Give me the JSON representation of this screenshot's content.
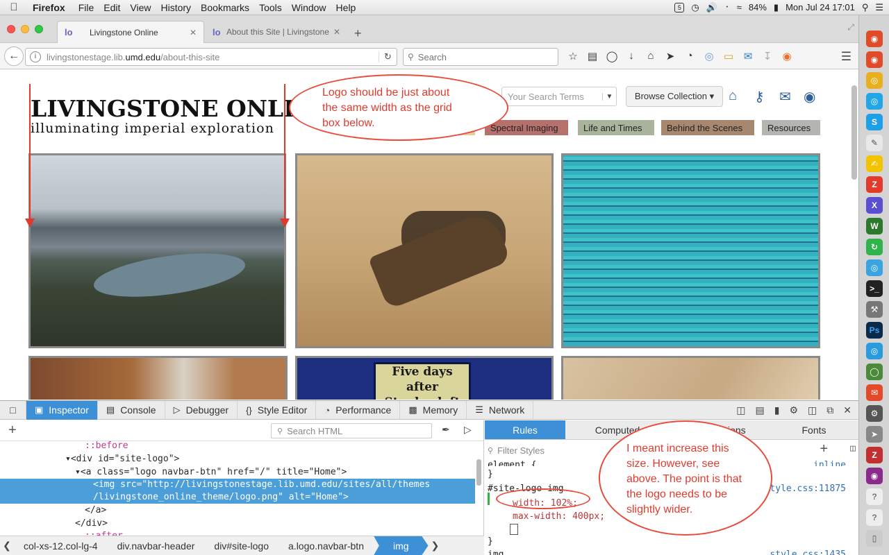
{
  "menubar": {
    "app": "Firefox",
    "items": [
      "File",
      "Edit",
      "View",
      "History",
      "Bookmarks",
      "Tools",
      "Window",
      "Help"
    ],
    "battery": "84%",
    "clock": "Mon Jul 24  17:01"
  },
  "tabs": [
    {
      "title": "Livingstone Online",
      "favicon": "lo"
    },
    {
      "title": "About this Site | Livingstone",
      "favicon": "lo"
    }
  ],
  "nav": {
    "url_host": "livingstonestage.lib.",
    "url_domain": "umd.edu",
    "url_path": "/about-this-site",
    "search_placeholder": "Search"
  },
  "page": {
    "logo_title": "LIVINGSTONE ONLINE",
    "logo_subtitle": "illuminating imperial exploration",
    "search_placeholder": "Your Search Terms",
    "browse_label": "Browse Collection ▾",
    "menu": [
      {
        "label": "Spectral Imaging",
        "color": "#b7716d"
      },
      {
        "label": "Life and Times",
        "color": "#a9b59a"
      },
      {
        "label": "Behind the Scenes",
        "color": "#a7886e"
      },
      {
        "label": "Resources",
        "color": "#b4b4b0"
      }
    ],
    "tile_text": "Five days after\nStanley left him.",
    "annotation_top": "Logo should be just about\nthe same width as the grid\nbox below.",
    "annotation_bottom": "I meant increase this\nsize. However, see\nabove. The point is that\nthe logo needs to be\nslightly wider."
  },
  "devtools": {
    "tabs": [
      "Inspector",
      "Console",
      "Debugger",
      "Style Editor",
      "Performance",
      "Memory",
      "Network"
    ],
    "search_html": "Search HTML",
    "markup": [
      "::before",
      "<div id=\"site-logo\">",
      "<a class=\"logo navbar-btn\" href=\"/\" title=\"Home\">",
      "<img src=\"http://livingstonestage.lib.umd.edu/sites/all/themes",
      "/livingstone_online_theme/logo.png\" alt=\"Home\">",
      "</a>",
      "</div>",
      "::after"
    ],
    "breadcrumbs": [
      "col-xs-12.col-lg-4",
      "div.navbar-header",
      "div#site-logo",
      "a.logo.navbar-btn",
      "img"
    ],
    "rules_tabs": [
      "Rules",
      "Computed",
      "Animations",
      "Fonts"
    ],
    "filter_placeholder": "Filter Styles",
    "rule_selector": "#site-logo img",
    "rule_decl_1": "width: 102%;",
    "rule_decl_2": "max-width: 400px;",
    "rule_source": "style.css:11875",
    "rule2_selector": "img",
    "rule2_source": "style.css:1435",
    "element_partial": "element {",
    "element_source": "inline"
  }
}
